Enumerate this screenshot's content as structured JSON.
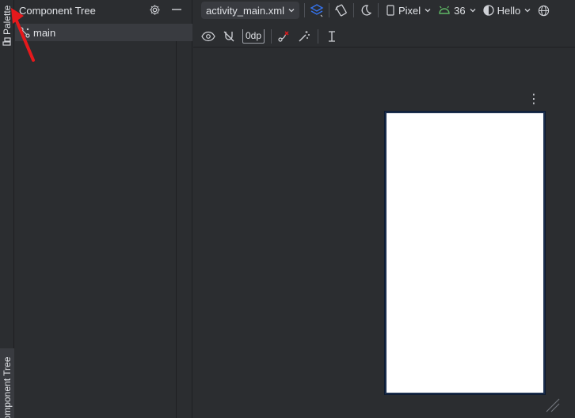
{
  "left_strip": {
    "palette_label": "Palette",
    "component_tree_label": "Component Tree"
  },
  "tree_panel": {
    "title": "Component Tree",
    "root_item": "main"
  },
  "toolbar": {
    "file": "activity_main.xml",
    "device": "Pixel",
    "api": "36",
    "theme": "Hello"
  },
  "toolbar2": {
    "margin": "0dp"
  },
  "colors": {
    "background": "#2b2d30",
    "panel_selected": "#393b40",
    "device_border": "#1b2e4d",
    "accent_blue": "#3574f0",
    "api_green": "#5fb865",
    "annotation_red": "#e5191c"
  },
  "icons": {
    "palette_tab": "palette-icon",
    "tree_row": "constraint-layout-icon",
    "settings": "gear-icon",
    "hide": "minimize-icon",
    "design_surface": "layers-icon",
    "orientation": "rotate-icon",
    "night_mode": "moon-icon",
    "device": "phone-icon",
    "api": "android-icon",
    "theme": "theme-icon",
    "locale": "globe-icon",
    "view_options": "eye-icon",
    "autoconnect": "magnet-off-icon",
    "clear_constraints": "clear-constraints-icon",
    "infer_constraints": "magic-wand-icon",
    "guidelines": "guideline-icon",
    "more": "more-vertical-icon",
    "resize": "resize-handle-icon"
  }
}
